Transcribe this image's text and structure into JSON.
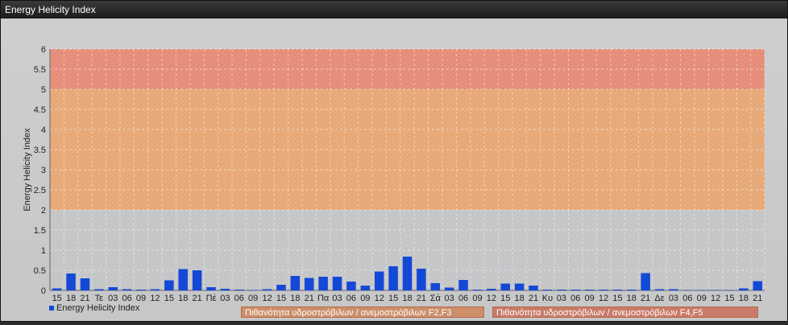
{
  "window": {
    "title": "Energy Helicity Index"
  },
  "chart_data": {
    "type": "bar",
    "ylabel": "Energy Helicity Index",
    "xlabel": "",
    "ylim": [
      0,
      6
    ],
    "yticks": [
      "0",
      "0.5",
      "1",
      "1.5",
      "2",
      "2.5",
      "3",
      "3.5",
      "4",
      "4.5",
      "5",
      "5.5",
      "6"
    ],
    "grid": true,
    "legend_position": "bottom-left",
    "bands": [
      {
        "from": 0,
        "to": 2,
        "color": "#c4c5c7"
      },
      {
        "from": 2,
        "to": 5,
        "color": "#e7a876"
      },
      {
        "from": 5,
        "to": 6,
        "color": "#e58c78"
      }
    ],
    "categories": [
      "15",
      "18",
      "21",
      "Τε",
      "03",
      "06",
      "09",
      "12",
      "15",
      "18",
      "21",
      "Πέ",
      "03",
      "06",
      "09",
      "12",
      "15",
      "18",
      "21",
      "Πα",
      "03",
      "06",
      "09",
      "12",
      "15",
      "18",
      "21",
      "Σά",
      "03",
      "06",
      "09",
      "12",
      "15",
      "18",
      "21",
      "Κυ",
      "03",
      "06",
      "09",
      "12",
      "15",
      "18",
      "21",
      "Δε",
      "03",
      "06",
      "09",
      "12",
      "15",
      "18",
      "21"
    ],
    "series": [
      {
        "name": "Energy Helicity Index",
        "color": "#1448d6",
        "values": [
          0.05,
          0.42,
          0.3,
          0.03,
          0.08,
          0.03,
          0.02,
          0.03,
          0.25,
          0.53,
          0.5,
          0.08,
          0.04,
          0.02,
          0.01,
          0.03,
          0.14,
          0.36,
          0.31,
          0.34,
          0.34,
          0.22,
          0.12,
          0.47,
          0.6,
          0.84,
          0.54,
          0.18,
          0.07,
          0.26,
          0.02,
          0.04,
          0.17,
          0.17,
          0.12,
          0.02,
          0.02,
          0.02,
          0.02,
          0.02,
          0.02,
          0.02,
          0.43,
          0.03,
          0.03,
          0.01,
          0.01,
          0.01,
          0.01,
          0.05,
          0.23
        ]
      }
    ]
  },
  "legend": {
    "series_label": "Energy Helicity Index",
    "bands": [
      {
        "label": "Πιθανότητα υδροστρόβιλων / ανεμοστρόβιλων F2,F3",
        "color": "#cc8f6a"
      },
      {
        "label": "Πιθανότητα υδροστρόβιλων / ανεμοστρόβιλων F4,F5",
        "color": "#c97a68"
      }
    ]
  }
}
